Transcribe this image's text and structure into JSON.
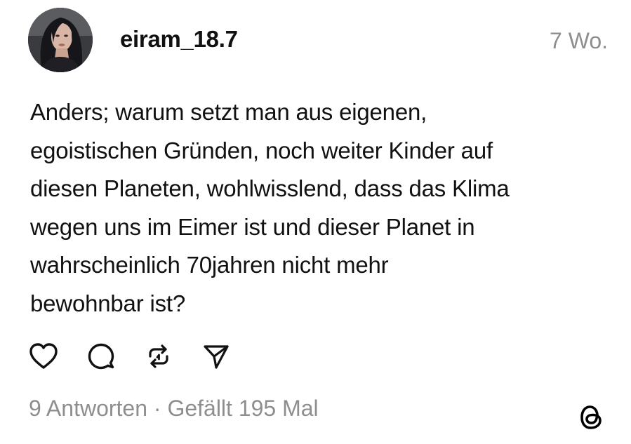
{
  "post": {
    "author": {
      "username": "eiram_18.7",
      "avatar_icon": "profile-photo"
    },
    "time_ago": "7 Wo.",
    "text_lines": [
      "Anders; warum setzt man aus eigenen,",
      "egoistischen Gründen, noch weiter Kinder auf",
      "diesen Planeten, wohlwisslend, dass das Klima",
      "wegen uns im Eimer ist und dieser Planet in",
      "wahrscheinlich 70jahren nicht mehr",
      "bewohnbar ist?"
    ],
    "actions": {
      "like_icon": "heart-icon",
      "reply_icon": "speech-bubble-icon",
      "repost_icon": "repost-icon",
      "share_icon": "send-icon"
    },
    "stats": {
      "replies": "9 Antworten",
      "separator": " · ",
      "likes": "Gefällt 195 Mal"
    },
    "app_logo": "threads-logo-icon"
  },
  "colors": {
    "text": "#111111",
    "muted": "#8e8e8e",
    "background": "#ffffff"
  }
}
